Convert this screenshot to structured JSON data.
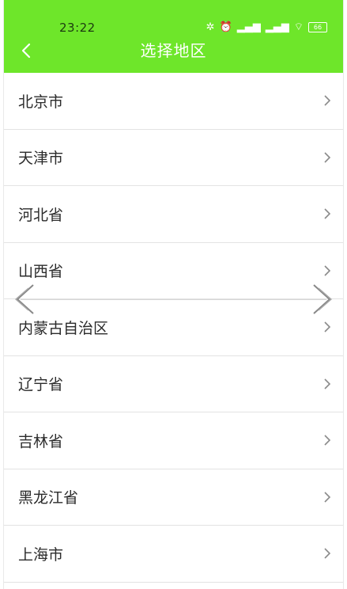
{
  "status_bar": {
    "time": "23:22",
    "battery": "66"
  },
  "header": {
    "title": "选择地区",
    "back_icon": "chevron-left-icon"
  },
  "regions": [
    {
      "label": "北京市"
    },
    {
      "label": "天津市"
    },
    {
      "label": "河北省"
    },
    {
      "label": "山西省"
    },
    {
      "label": "内蒙古自治区"
    },
    {
      "label": "辽宁省"
    },
    {
      "label": "吉林省"
    },
    {
      "label": "黑龙江省"
    },
    {
      "label": "上海市"
    }
  ],
  "colors": {
    "accent": "#6ee62a",
    "text": "#2b2b2b",
    "divider": "#e3e3e3"
  }
}
